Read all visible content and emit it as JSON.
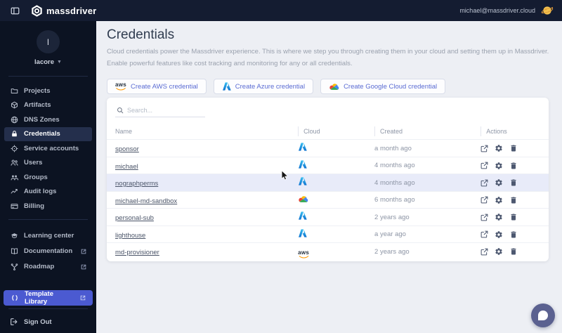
{
  "header": {
    "brand": "massdriver",
    "user_email": "michael@massdriver.cloud"
  },
  "sidebar": {
    "org": {
      "avatar_letter": "l",
      "name": "lacore"
    },
    "nav_items": [
      {
        "label": "Projects",
        "icon": "folder-icon"
      },
      {
        "label": "Artifacts",
        "icon": "artifact-icon"
      },
      {
        "label": "DNS Zones",
        "icon": "globe-icon"
      },
      {
        "label": "Credentials",
        "icon": "lock-icon",
        "active": true
      },
      {
        "label": "Service accounts",
        "icon": "target-icon"
      },
      {
        "label": "Users",
        "icon": "users-icon"
      },
      {
        "label": "Groups",
        "icon": "group-icon"
      },
      {
        "label": "Audit logs",
        "icon": "chart-icon"
      },
      {
        "label": "Billing",
        "icon": "credit-card-icon"
      }
    ],
    "secondary_items": [
      {
        "label": "Learning center",
        "icon": "graduation-cap-icon",
        "external": false
      },
      {
        "label": "Documentation",
        "icon": "book-icon",
        "external": true
      },
      {
        "label": "Roadmap",
        "icon": "roadmap-icon",
        "external": true
      }
    ],
    "template_library": {
      "label": "Template Library",
      "icon": "code-brackets-icon",
      "external": true
    },
    "sign_out": {
      "label": "Sign Out",
      "icon": "sign-out-icon"
    }
  },
  "main": {
    "title": "Credentials",
    "description": "Cloud credentials power the Massdriver experience. This is where we step you through creating them in your cloud and setting them up in Massdriver. Enable powerful features like cost tracking and monitoring for any or all credentials.",
    "create_buttons": [
      {
        "label": "Create AWS credential",
        "icon": "aws-icon"
      },
      {
        "label": "Create Azure credential",
        "icon": "azure-icon"
      },
      {
        "label": "Create Google Cloud credential",
        "icon": "google-cloud-icon"
      }
    ],
    "search": {
      "placeholder": "Search..."
    },
    "table": {
      "columns": [
        "Name",
        "Cloud",
        "Created",
        "Actions"
      ],
      "rows": [
        {
          "name": "sponsor",
          "cloud": "azure",
          "created": "a month ago",
          "highlighted": false
        },
        {
          "name": "michael",
          "cloud": "azure",
          "created": "4 months ago",
          "highlighted": false
        },
        {
          "name": "nographperms",
          "cloud": "azure",
          "created": "4 months ago",
          "highlighted": true
        },
        {
          "name": "michael-md-sandbox",
          "cloud": "gcp",
          "created": "6 months ago",
          "highlighted": false
        },
        {
          "name": "personal-sub",
          "cloud": "azure",
          "created": "2 years ago",
          "highlighted": false
        },
        {
          "name": "lighthouse",
          "cloud": "azure",
          "created": "a year ago",
          "highlighted": false
        },
        {
          "name": "md-provisioner",
          "cloud": "aws",
          "created": "2 years ago",
          "highlighted": false
        }
      ],
      "row_actions": [
        "open-icon",
        "gear-icon",
        "trash-icon"
      ]
    }
  },
  "colors": {
    "accent": "#4b5ad1",
    "topbar_bg": "#141c31",
    "sidebar_bg": "#0c1322",
    "highlight_row": "#e8ebf9",
    "aws_orange": "#ff9900",
    "azure_blue": "#2493e0",
    "gcp_red": "#ea4335",
    "gcp_yellow": "#fbbc05",
    "gcp_blue": "#4285f4",
    "gcp_green": "#34a853"
  }
}
